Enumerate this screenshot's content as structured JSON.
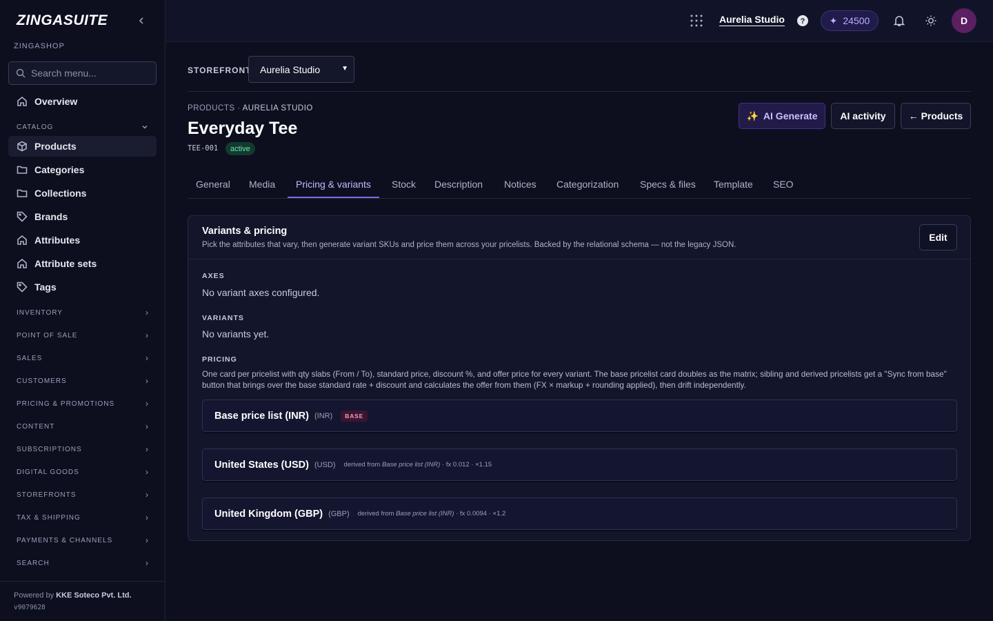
{
  "brand": "ZINGASUITE",
  "shop": "ZINGASHOP",
  "search": {
    "placeholder": "Search menu..."
  },
  "nav": {
    "overview": "Overview",
    "catalog_section": "CATALOG",
    "catalog_items": [
      "Products",
      "Categories",
      "Collections",
      "Brands",
      "Attributes",
      "Attribute sets",
      "Tags"
    ],
    "sections": [
      "INVENTORY",
      "POINT OF SALE",
      "SALES",
      "CUSTOMERS",
      "PRICING & PROMOTIONS",
      "CONTENT",
      "SUBSCRIPTIONS",
      "DIGITAL GOODS",
      "STOREFRONTS",
      "TAX & SHIPPING",
      "PAYMENTS & CHANNELS",
      "SEARCH"
    ]
  },
  "footer": {
    "powered_prefix": "Powered by",
    "company": "KKE Soteco Pvt. Ltd.",
    "version": "v9079628"
  },
  "topbar": {
    "studio": "Aurelia Studio",
    "credits": "24500",
    "avatar": "D"
  },
  "storefront": {
    "label": "STOREFRONT",
    "selected": "Aurelia Studio"
  },
  "breadcrumb": {
    "first": "PRODUCTS",
    "sep": " · ",
    "second": "AURELIA STUDIO"
  },
  "product": {
    "title": "Everyday Tee",
    "sku": "TEE-001",
    "status": "active"
  },
  "actions": {
    "ai_generate": "AI Generate",
    "ai_activity": "AI activity",
    "products": "← Products"
  },
  "tabs": [
    "General",
    "Media",
    "Pricing & variants",
    "Stock",
    "Description",
    "Notices",
    "Categorization",
    "Specs & files",
    "Template",
    "SEO"
  ],
  "active_tab": "Pricing & variants",
  "card": {
    "title": "Variants & pricing",
    "subtitle": "Pick the attributes that vary, then generate variant SKUs and price them across your pricelists. Backed by the relational schema — not the legacy JSON.",
    "edit": "Edit",
    "axes_label": "AXES",
    "axes_value": "No variant axes configured.",
    "variants_label": "VARIANTS",
    "variants_value": "No variants yet.",
    "pricing_label": "PRICING",
    "pricing_desc": "One card per pricelist with qty slabs (From / To), standard price, discount %, and offer price for every variant. The base pricelist card doubles as the matrix; sibling and derived pricelists get a \"Sync from base\" button that brings over the base standard rate + discount and calculates the offer from them (FX × markup + rounding applied), then drift independently."
  },
  "pricelists": [
    {
      "name": "Base price list (INR)",
      "currency": "(INR)",
      "badge": "BASE",
      "derived_prefix": "",
      "derived_from": "",
      "derived_suffix": ""
    },
    {
      "name": "United States (USD)",
      "currency": "(USD)",
      "badge": "",
      "derived_prefix": "derived from ",
      "derived_from": "Base price list (INR)",
      "derived_suffix": " · fx 0.012 · ×1.15"
    },
    {
      "name": "United Kingdom (GBP)",
      "currency": "(GBP)",
      "badge": "",
      "derived_prefix": "derived from ",
      "derived_from": "Base price list (INR)",
      "derived_suffix": " · fx 0.0094 · ×1.2"
    }
  ],
  "colors": {
    "accent": "#7c6ae0",
    "background": "#0d0f1f",
    "status_active": "#6fe3b0"
  }
}
